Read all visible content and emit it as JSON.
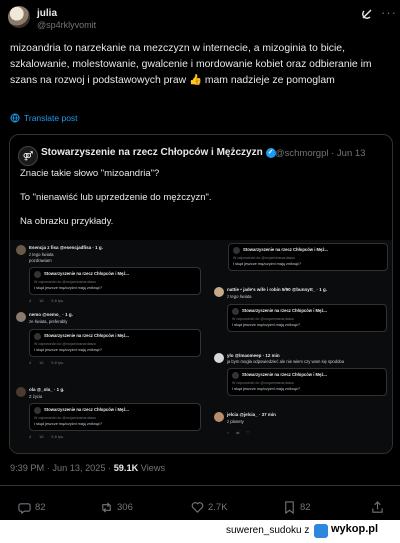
{
  "author": {
    "name": "julia",
    "handle": "@sp4rklyvomit"
  },
  "post_text": "mizoandria to narzekanie na mezczyzn w internecie, a mizoginia to bicie, szkalowanie, molestowanie, gwalcenie i mordowanie kobiet oraz odbieranie im szans na rozwoj i podstawowych praw 👍 mam nadzieje ze pomoglam",
  "translate_label": "Translate post",
  "quote": {
    "name": "Stowarzyszenie na rzecz Chłopców i Mężczyzn",
    "handle_date": "@schmorgpl · Jun 13",
    "line1": "Znacie takie słowo \"mizoandria\"?",
    "line2": "To \"nienawiść lub uprzedzenie do mężczyzn\".",
    "line3": "Na obrazku przykłady.",
    "screenshot": {
      "left": [
        {
          "name": "Esencja z fisa @esencjadfisa · 1 g.",
          "text1": "z tego świata",
          "text2": "pozdrawiam"
        },
        {
          "name": "nemo @nemo_ · 1 g.",
          "text1": "ze świata, preferably",
          "text2": ""
        },
        {
          "name": "ola @_ola_ · 1 g.",
          "text1": "Z życia",
          "text2": ""
        }
      ],
      "right": [
        {
          "name": "nattie • jade's wife i robin 5/90 @bunnytt_ · 1 g.",
          "text1": "z tego świata",
          "text2": ""
        },
        {
          "name": "ylo @lmaomeep · 12 min",
          "text1": "ja bym mogła odpowiedzieć ale nie wiem czy wam się spodoba",
          "text2": ""
        },
        {
          "name": "jelcia @jelcia_ · 37 min",
          "text1": "z planety",
          "text2": ""
        }
      ],
      "card_title": "Stowarzyszenie na rzecz Chłopców i Męż...",
      "card_sub": "W odpowiedzi do @mojamlosnardasoc",
      "card_body": "I skąd jeszcze mężczyźni mają zniknąć?",
      "card_actions": [
        "4",
        "16",
        "5,6 tys."
      ]
    }
  },
  "meta": {
    "time": "9:39 PM · Jun 13, 2025 · ",
    "views": "59.1K",
    "views_label": " Views"
  },
  "actions": {
    "replies": "82",
    "reposts": "306",
    "likes": "2.7K",
    "bookmarks": "82"
  },
  "footer": {
    "user": "suweren_sudoku z",
    "site": "wykop.pl"
  }
}
